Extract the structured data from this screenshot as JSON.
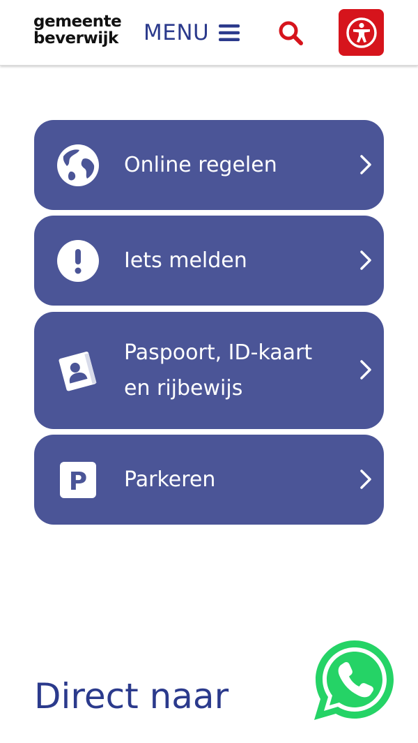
{
  "header": {
    "logo_line1": "gemeente",
    "logo_line2": "beverwijk",
    "menu_label": "MENU",
    "icons": {
      "menu": "hamburger-icon",
      "search": "search-icon",
      "accessibility": "accessibility-icon"
    }
  },
  "tiles": [
    {
      "label": "Online regelen",
      "icon": "globe-icon"
    },
    {
      "label_line1": "Iets melden",
      "icon": "exclamation-icon"
    },
    {
      "label_line1": "Paspoort, ID-kaart",
      "label_line2": "en rijbewijs",
      "icon": "passport-icon"
    },
    {
      "label": "Parkeren",
      "icon": "parking-icon"
    }
  ],
  "section": {
    "title": "Direct naar"
  },
  "colors": {
    "brand_blue": "#2b3a8c",
    "tile_bg": "#4b5597",
    "accent_red": "#d6141c",
    "whatsapp_green": "#25d366"
  }
}
